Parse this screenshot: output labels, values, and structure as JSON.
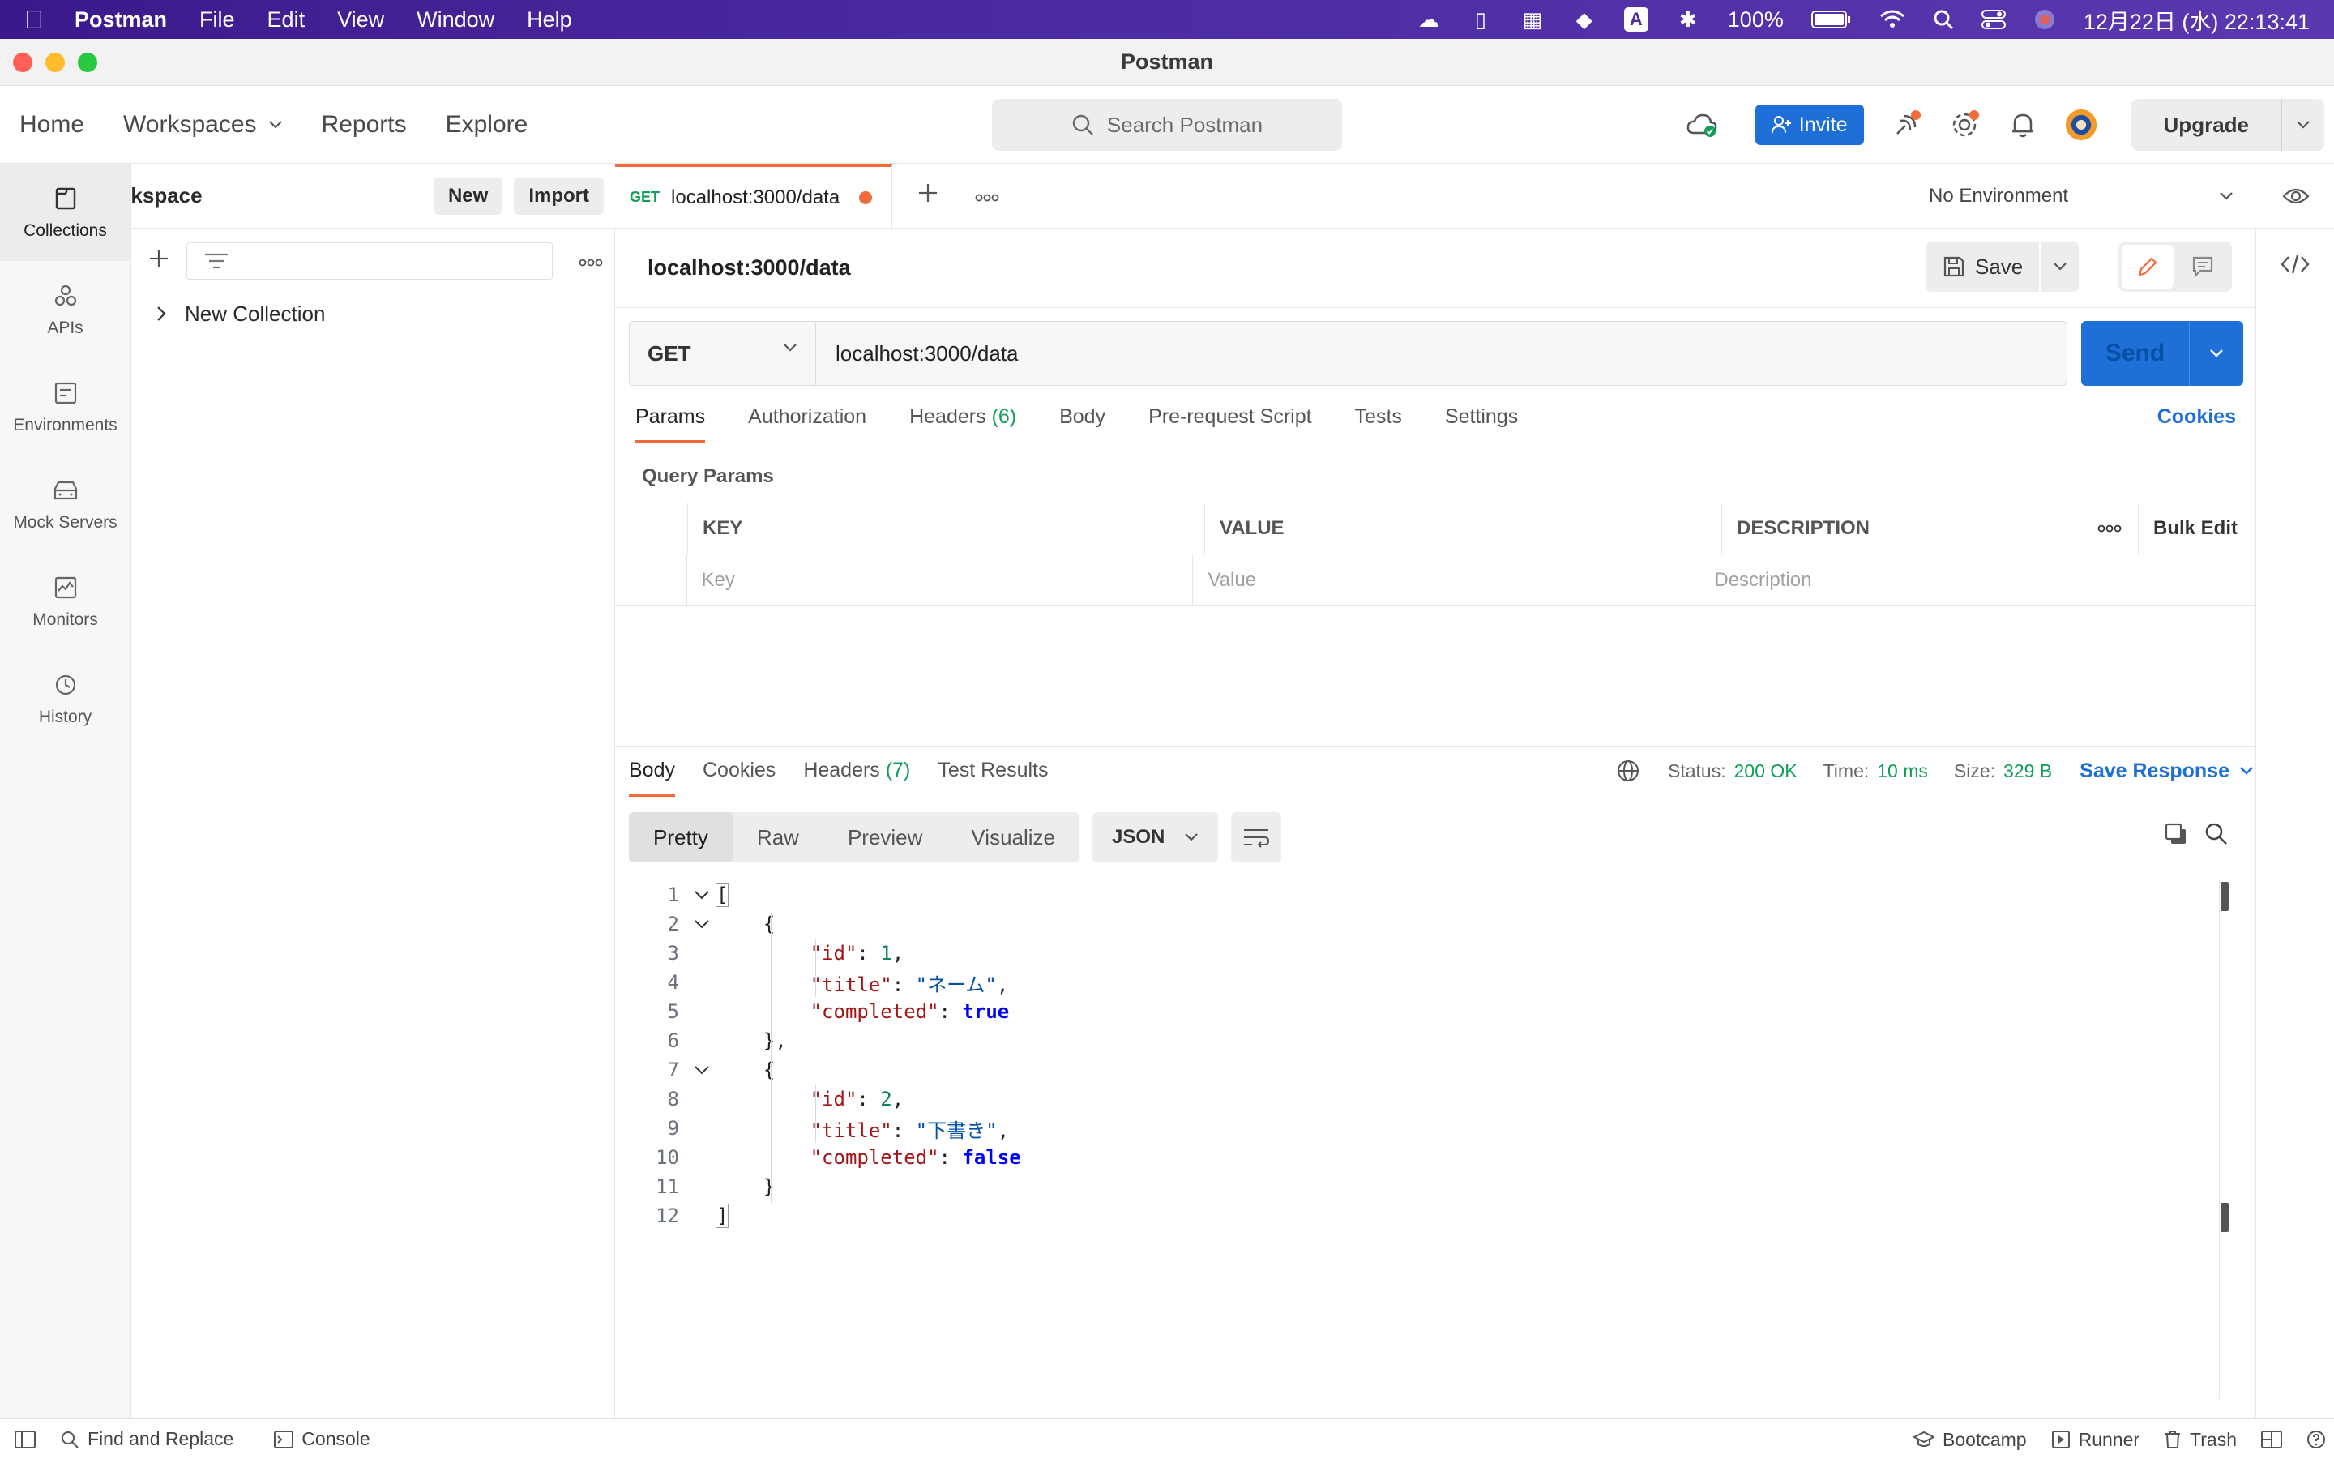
{
  "menubar": {
    "app_name": "Postman",
    "items": [
      "File",
      "Edit",
      "View",
      "Window",
      "Help"
    ],
    "battery": "100%",
    "datetime": "12月22日 (水)  22:13:41"
  },
  "window": {
    "title": "Postman"
  },
  "header": {
    "nav": [
      "Home",
      "Workspaces",
      "Reports",
      "Explore"
    ],
    "search_placeholder": "Search Postman",
    "invite_label": "Invite",
    "upgrade_label": "Upgrade"
  },
  "leftnav": {
    "items": [
      {
        "label": "Collections",
        "icon": "collections-icon"
      },
      {
        "label": "APIs",
        "icon": "apis-icon"
      },
      {
        "label": "Environments",
        "icon": "environments-icon"
      },
      {
        "label": "Mock Servers",
        "icon": "mock-servers-icon"
      },
      {
        "label": "Monitors",
        "icon": "monitors-icon"
      },
      {
        "label": "History",
        "icon": "history-icon"
      }
    ]
  },
  "sidebar": {
    "workspace": "My Workspace",
    "new_label": "New",
    "import_label": "Import",
    "collection": "New Collection"
  },
  "tabs": {
    "active_method": "GET",
    "active_title": "localhost:3000/data",
    "environment": "No Environment"
  },
  "request": {
    "title": "localhost:3000/data",
    "save_label": "Save",
    "method": "GET",
    "url": "localhost:3000/data",
    "send_label": "Send",
    "subtabs": [
      "Params",
      "Authorization",
      "Headers",
      "Body",
      "Pre-request Script",
      "Tests",
      "Settings"
    ],
    "headers_count": "(6)",
    "cookies_label": "Cookies",
    "query_params_title": "Query Params",
    "params_headers": [
      "KEY",
      "VALUE",
      "DESCRIPTION"
    ],
    "bulk_edit": "Bulk Edit",
    "placeholders": [
      "Key",
      "Value",
      "Description"
    ]
  },
  "response": {
    "tabs": [
      "Body",
      "Cookies",
      "Headers",
      "Test Results"
    ],
    "headers_count": "(7)",
    "status_label": "Status:",
    "status_value": "200 OK",
    "time_label": "Time:",
    "time_value": "10 ms",
    "size_label": "Size:",
    "size_value": "329 B",
    "save_response": "Save Response",
    "views": [
      "Pretty",
      "Raw",
      "Preview",
      "Visualize"
    ],
    "format": "JSON"
  },
  "code_lines": [
    "1",
    "2",
    "3",
    "4",
    "5",
    "6",
    "7",
    "8",
    "9",
    "10",
    "11",
    "12"
  ],
  "json_body": {
    "items": [
      {
        "id": "1",
        "title": "\"ネーム\"",
        "completed": "true"
      },
      {
        "id": "2",
        "title": "\"下書き\"",
        "completed": "false"
      }
    ],
    "keys": {
      "id": "\"id\"",
      "title": "\"title\"",
      "completed": "\"completed\""
    }
  },
  "statusbar": {
    "find_replace": "Find and Replace",
    "console": "Console",
    "bootcamp": "Bootcamp",
    "runner": "Runner",
    "trash": "Trash"
  }
}
